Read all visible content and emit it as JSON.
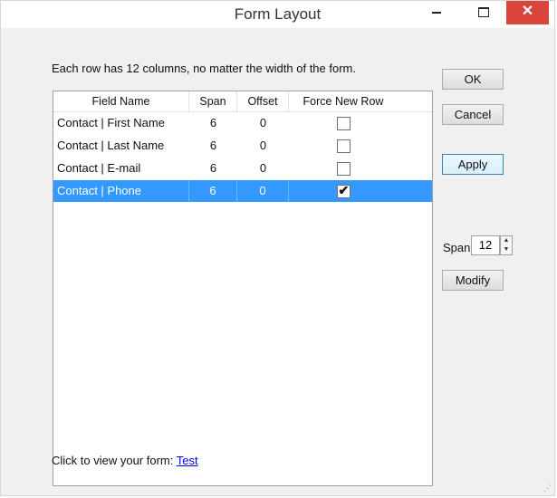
{
  "window": {
    "title": "Form Layout",
    "close_glyph": "✕"
  },
  "description": "Each row has 12 columns, no matter the width of the form.",
  "grid": {
    "columns": [
      "Field Name",
      "Span",
      "Offset",
      "Force New Row"
    ],
    "rows": [
      {
        "field": "Contact | First Name",
        "span": "6",
        "offset": "0",
        "force_new_row": false,
        "selected": false
      },
      {
        "field": "Contact | Last Name",
        "span": "6",
        "offset": "0",
        "force_new_row": false,
        "selected": false
      },
      {
        "field": "Contact | E-mail",
        "span": "6",
        "offset": "0",
        "force_new_row": false,
        "selected": false
      },
      {
        "field": "Contact | Phone",
        "span": "6",
        "offset": "0",
        "force_new_row": true,
        "selected": true
      }
    ]
  },
  "buttons": {
    "ok": "OK",
    "cancel": "Cancel",
    "apply": "Apply",
    "modify": "Modify"
  },
  "span_control": {
    "label": "Span",
    "value": "12"
  },
  "footer": {
    "text": "Click to view your form:",
    "link": "Test"
  },
  "colors": {
    "selection": "#3399ff",
    "close_button": "#d9453b"
  },
  "icons": {
    "minimize": "minimize-icon",
    "maximize": "maximize-icon",
    "close": "close-icon",
    "check": "checkmark-icon",
    "spin_up": "chevron-up-icon",
    "spin_down": "chevron-down-icon",
    "grip": "resize-grip-icon"
  }
}
